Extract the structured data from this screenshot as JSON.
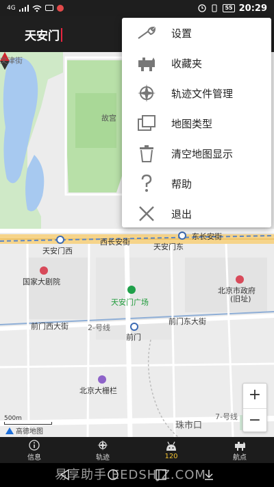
{
  "status_bar": {
    "signal": "4G",
    "battery": "55",
    "time": "20:29"
  },
  "search": {
    "value": "天安门"
  },
  "menu": {
    "items": [
      {
        "label": "设置",
        "icon": "wrench-icon"
      },
      {
        "label": "收藏夹",
        "icon": "favorites-icon"
      },
      {
        "label": "轨迹文件管理",
        "icon": "track-files-icon"
      },
      {
        "label": "地图类型",
        "icon": "map-layers-icon"
      },
      {
        "label": "清空地图显示",
        "icon": "trash-icon"
      },
      {
        "label": "帮助",
        "icon": "help-icon"
      },
      {
        "label": "退出",
        "icon": "close-icon"
      }
    ]
  },
  "map": {
    "labels": {
      "gugong": "故宫",
      "tiananmen_west": "天安门西",
      "xichangan": "西长安街",
      "tiananmen_east": "天安门东",
      "dongchangan": "东长安街",
      "theatre": "国家大剧院",
      "square": "天安门广场",
      "city_gov": "北京市政府",
      "city_gov_sub": "(旧址)",
      "qianmen_west": "前门西大街",
      "line2": "2-号线",
      "qianmen_east": "前门东大街",
      "qianmen": "前门",
      "dashilan": "北京大栅栏",
      "zhushikou": "珠市口",
      "line7": "7-号线",
      "wenjin": "文津街"
    },
    "scale": "500m",
    "provider": "高德地图",
    "zoom_in": "+",
    "zoom_out": "−"
  },
  "bottom_nav": [
    {
      "label": "信息",
      "icon": "info-icon"
    },
    {
      "label": "轨迹",
      "icon": "compass-icon"
    },
    {
      "label": "120",
      "icon": "robot-icon"
    },
    {
      "label": "航点",
      "icon": "waypoint-icon"
    }
  ],
  "watermark": "易享助手 EEDSHJZ.COM",
  "colors": {
    "topbar": "#1f1f1f",
    "active_tab": "#f2c230",
    "caret": "#e8253f"
  }
}
